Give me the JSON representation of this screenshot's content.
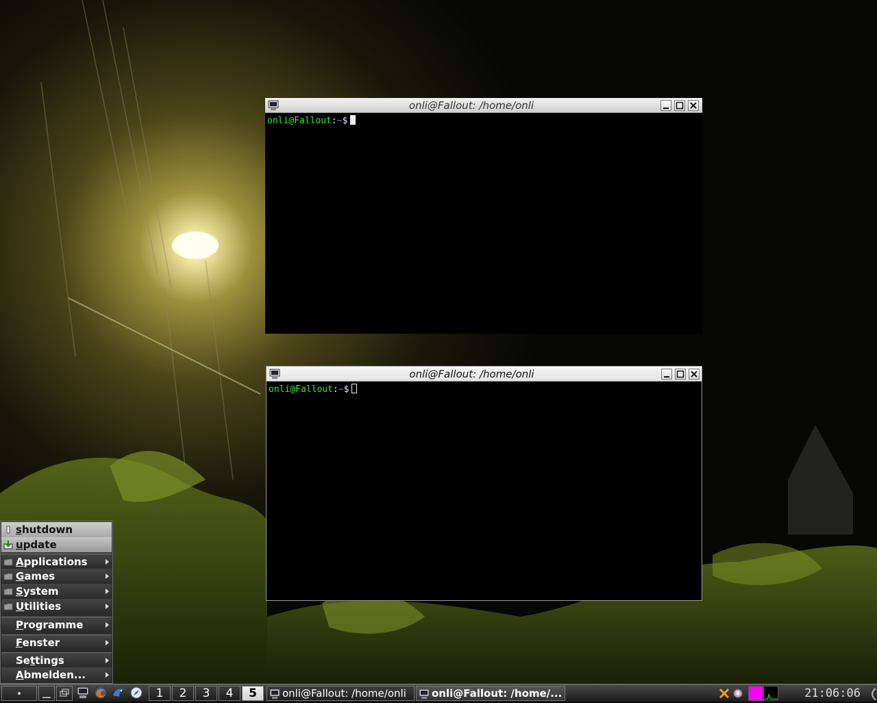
{
  "windows": [
    {
      "title": "onli@Fallout: /home/onli",
      "prompt_user": "onli@Fallout",
      "prompt_sep": ":",
      "prompt_path": "~",
      "prompt_symbol": "$"
    },
    {
      "title": "onli@Fallout: /home/onli",
      "prompt_user": "onli@Fallout",
      "prompt_sep": ":",
      "prompt_path": "~",
      "prompt_symbol": "$"
    }
  ],
  "menu": {
    "items": [
      {
        "accel": "s",
        "rest": "hutdown"
      },
      {
        "accel": "u",
        "rest": "pdate"
      },
      {
        "accel": "A",
        "rest": "pplications"
      },
      {
        "accel": "G",
        "rest": "ames"
      },
      {
        "accel": "S",
        "rest": "ystem"
      },
      {
        "accel": "U",
        "rest": "tilities"
      },
      {
        "accel": "P",
        "rest": "rogramme"
      },
      {
        "accel": "F",
        "rest": "enster"
      },
      {
        "pre": "Se",
        "accel": "t",
        "rest": "tings"
      },
      {
        "accel": "A",
        "rest": "bmelden..."
      }
    ]
  },
  "taskbar": {
    "desktops": [
      "1",
      "2",
      "3",
      "4",
      "5"
    ],
    "current_desktop": "5",
    "tasks": [
      "onli@Fallout: /home/onli",
      "onli@Fallout: /home/..."
    ],
    "clock": "21:06:06"
  },
  "colors": {
    "prompt_user": "#3ee83e",
    "prompt_path": "#5c8cff",
    "tray_accent": "#ff00ff"
  },
  "icons": {
    "terminal": "terminal-icon",
    "folder": "folder-icon",
    "shutdown": "power-icon",
    "update": "download-icon"
  }
}
